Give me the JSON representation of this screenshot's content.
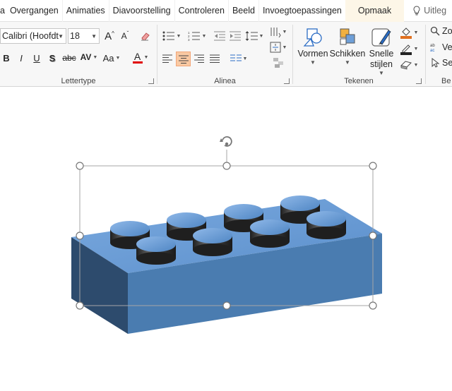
{
  "tabs": [
    {
      "label": "a",
      "name": "tab-partial"
    },
    {
      "label": "Overgangen",
      "name": "tab-overgangen"
    },
    {
      "label": "Animaties",
      "name": "tab-animaties"
    },
    {
      "label": "Diavoorstelling",
      "name": "tab-diavoorstelling"
    },
    {
      "label": "Controleren",
      "name": "tab-controleren"
    },
    {
      "label": "Beeld",
      "name": "tab-beeld"
    },
    {
      "label": "Invoegtoepassingen",
      "name": "tab-invoegtoepassingen"
    },
    {
      "label": "Opmaak",
      "name": "tab-opmaak"
    }
  ],
  "tell_me": "Uitleg",
  "font": {
    "name": "Calibri (Hoofdt",
    "size": "18",
    "bold": "B",
    "italic": "I",
    "underline": "U",
    "shadow": "S",
    "strike": "abc",
    "spacing": "AV",
    "case": "Aa",
    "color_letter": "A",
    "grow": "A",
    "shrink": "A"
  },
  "groups": {
    "lettertype": "Lettertype",
    "alinea": "Alinea",
    "tekenen": "Tekenen",
    "bewerken": "Be"
  },
  "drawing": {
    "shapes": "Vormen",
    "arrange": "Schikken",
    "quick_styles_1": "Snelle",
    "quick_styles_2": "stijlen"
  },
  "editing": {
    "find": "Zo",
    "replace": "Ve",
    "select": "Se"
  },
  "colors": {
    "accent": "#c43e1c",
    "selection_line": "#a6a6a6",
    "brick_top": "#6e9fd8",
    "brick_front": "#4a7fb5",
    "brick_side": "#2f4f72",
    "font_color_bar": "#e00000",
    "fill_bar": "#e07020"
  }
}
